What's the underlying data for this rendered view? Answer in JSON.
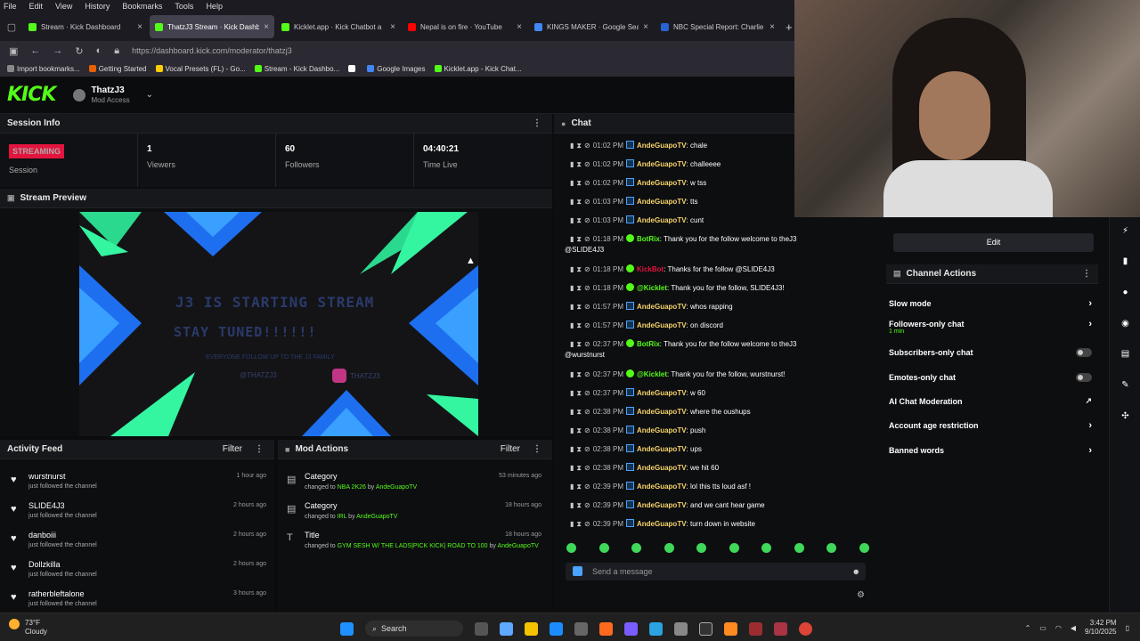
{
  "browser": {
    "menu": [
      "File",
      "Edit",
      "View",
      "History",
      "Bookmarks",
      "Tools",
      "Help"
    ],
    "tabs": [
      {
        "title": "Stream · Kick Dashboard",
        "color": "#53fc18",
        "active": false
      },
      {
        "title": "ThatzJ3 Stream · Kick Dashb",
        "color": "#53fc18",
        "active": true
      },
      {
        "title": "Kicklet.app · Kick Chatbot a",
        "color": "#53fc18",
        "active": false
      },
      {
        "title": "Nepal is on fire · YouTube",
        "color": "#ff0000",
        "active": false
      },
      {
        "title": "KINGS MAKER · Google Search",
        "color": "#4285f4",
        "active": false
      },
      {
        "title": "NBC Special Report: Charlie Kir",
        "color": "#2a62d4",
        "active": false
      }
    ],
    "url": "https://dashboard.kick.com/moderator/thatzj3",
    "bookmarks": [
      {
        "label": "Import bookmarks...",
        "color": "#888"
      },
      {
        "label": "Getting Started",
        "color": "#e66000"
      },
      {
        "label": "Vocal Presets (FL) - Go...",
        "color": "#ffcc00"
      },
      {
        "label": "Stream - Kick Dashbo...",
        "color": "#53fc18"
      },
      {
        "label": "",
        "color": "#ffffff"
      },
      {
        "label": "Google Images",
        "color": "#4285f4"
      },
      {
        "label": "Kicklet.app - Kick Chat...",
        "color": "#53fc18"
      }
    ]
  },
  "header": {
    "logo": "KICK",
    "username": "ThatzJ3",
    "role": "Mod Access"
  },
  "session": {
    "title": "Session Info",
    "badge": "STREAMING",
    "badge_label": "Session",
    "viewers": "1",
    "viewers_label": "Viewers",
    "followers": "60",
    "followers_label": "Followers",
    "time_live": "04:40:21",
    "time_live_label": "Time Live"
  },
  "preview": {
    "title": "Stream Preview",
    "line1": "J3 IS STARTING STREAM",
    "line2": "STAY TUNED!!!!!!",
    "line3": "EVERYONE FOLLOW UP TO THE J3 FAMILY",
    "social1": "@THATZJ3",
    "social2": "THATZJ3"
  },
  "activity": {
    "title": "Activity Feed",
    "filter": "Filter",
    "items": [
      {
        "name": "wurstnurst",
        "sub": "just followed the channel",
        "time": "1 hour ago"
      },
      {
        "name": "SLIDE4J3",
        "sub": "just followed the channel",
        "time": "2 hours ago"
      },
      {
        "name": "danboiii",
        "sub": "just followed the channel",
        "time": "2 hours ago"
      },
      {
        "name": "Dollzkilla",
        "sub": "just followed the channel",
        "time": "2 hours ago"
      },
      {
        "name": "ratherbleftalone",
        "sub": "just followed the channel",
        "time": "3 hours ago"
      }
    ]
  },
  "modactions": {
    "title": "Mod Actions",
    "filter": "Filter",
    "items": [
      {
        "title": "Category",
        "pre": "changed to ",
        "value": "NBA 2K26",
        "by": " by ",
        "user": "AndeGuapoTV",
        "time": "53 minutes ago"
      },
      {
        "title": "Category",
        "pre": "changed to ",
        "value": "IRL",
        "by": " by ",
        "user": "AndeGuapoTV",
        "time": "18 hours ago"
      },
      {
        "title": "Title",
        "pre": "changed to ",
        "value": "GYM SESH W/ THE LADS|PICK KICK| ROAD TO 100",
        "by": " by ",
        "user": "AndeGuapoTV",
        "time": "18 hours ago"
      }
    ]
  },
  "chat": {
    "title": "Chat",
    "messages": [
      {
        "time": "01:02 PM",
        "user": "AndeGuapoTV",
        "text": ": chale",
        "kind": "y"
      },
      {
        "time": "01:02 PM",
        "user": "AndeGuapoTV",
        "text": ": challeeee",
        "kind": "y"
      },
      {
        "time": "01:02 PM",
        "user": "AndeGuapoTV",
        "text": ": w tss",
        "kind": "y"
      },
      {
        "time": "01:03 PM",
        "user": "AndeGuapoTV",
        "text": ": tts",
        "kind": "y"
      },
      {
        "time": "01:03 PM",
        "user": "AndeGuapoTV",
        "text": ": cunt",
        "kind": "y"
      },
      {
        "time": "01:18 PM",
        "user": "BotRix",
        "text": ": Thank you for the follow welcome to theJ3",
        "cont": "@SLIDE4J3",
        "kind": "g"
      },
      {
        "time": "01:18 PM",
        "user": "KickBot",
        "text": ": Thanks for the follow @SLIDE4J3",
        "kind": "r"
      },
      {
        "time": "01:18 PM",
        "user": "@Kicklet",
        "text": ": Thank you for the follow, SLIDE4J3!",
        "kind": "g"
      },
      {
        "time": "01:57 PM",
        "user": "AndeGuapoTV",
        "text": ": whos rapping",
        "kind": "y"
      },
      {
        "time": "01:57 PM",
        "user": "AndeGuapoTV",
        "text": ": on discord",
        "kind": "y"
      },
      {
        "time": "02:37 PM",
        "user": "BotRix",
        "text": ": Thank you for the follow welcome to theJ3",
        "cont": "@wurstnurst",
        "kind": "g"
      },
      {
        "time": "02:37 PM",
        "user": "@Kicklet",
        "text": ": Thank you for the follow, wurstnurst!",
        "kind": "g"
      },
      {
        "time": "02:37 PM",
        "user": "AndeGuapoTV",
        "text": ": w 60",
        "kind": "y"
      },
      {
        "time": "02:38 PM",
        "user": "AndeGuapoTV",
        "text": ": where the oushups",
        "kind": "y"
      },
      {
        "time": "02:38 PM",
        "user": "AndeGuapoTV",
        "text": ": push",
        "kind": "y"
      },
      {
        "time": "02:38 PM",
        "user": "AndeGuapoTV",
        "text": ": ups",
        "kind": "y"
      },
      {
        "time": "02:38 PM",
        "user": "AndeGuapoTV",
        "text": ": we hit 60",
        "kind": "y"
      },
      {
        "time": "02:39 PM",
        "user": "AndeGuapoTV",
        "text": ": lol this tts loud asf !",
        "kind": "y"
      },
      {
        "time": "02:39 PM",
        "user": "AndeGuapoTV",
        "text": ": and we cant hear game",
        "kind": "y"
      },
      {
        "time": "02:39 PM",
        "user": "AndeGuapoTV",
        "text": ": turn down in website",
        "kind": "y"
      }
    ],
    "placeholder": "Send a message"
  },
  "right": {
    "edit": "Edit",
    "channel_actions": "Channel Actions",
    "slow_mode": "Slow mode",
    "followers_only": "Followers-only chat",
    "followers_only_sub": "1 min",
    "subscribers_only": "Subscribers-only chat",
    "emotes_only": "Emotes-only chat",
    "ai_mod": "AI Chat Moderation",
    "age_restriction": "Account age restriction",
    "banned_words": "Banned words"
  },
  "taskbar": {
    "temp": "73°F",
    "condition": "Cloudy",
    "search": "Search",
    "time": "3:42 PM",
    "date": "9/10/2025"
  },
  "colors": {
    "accent": "#53fc18",
    "live": "#e3143d",
    "user": "#f5d36b"
  }
}
